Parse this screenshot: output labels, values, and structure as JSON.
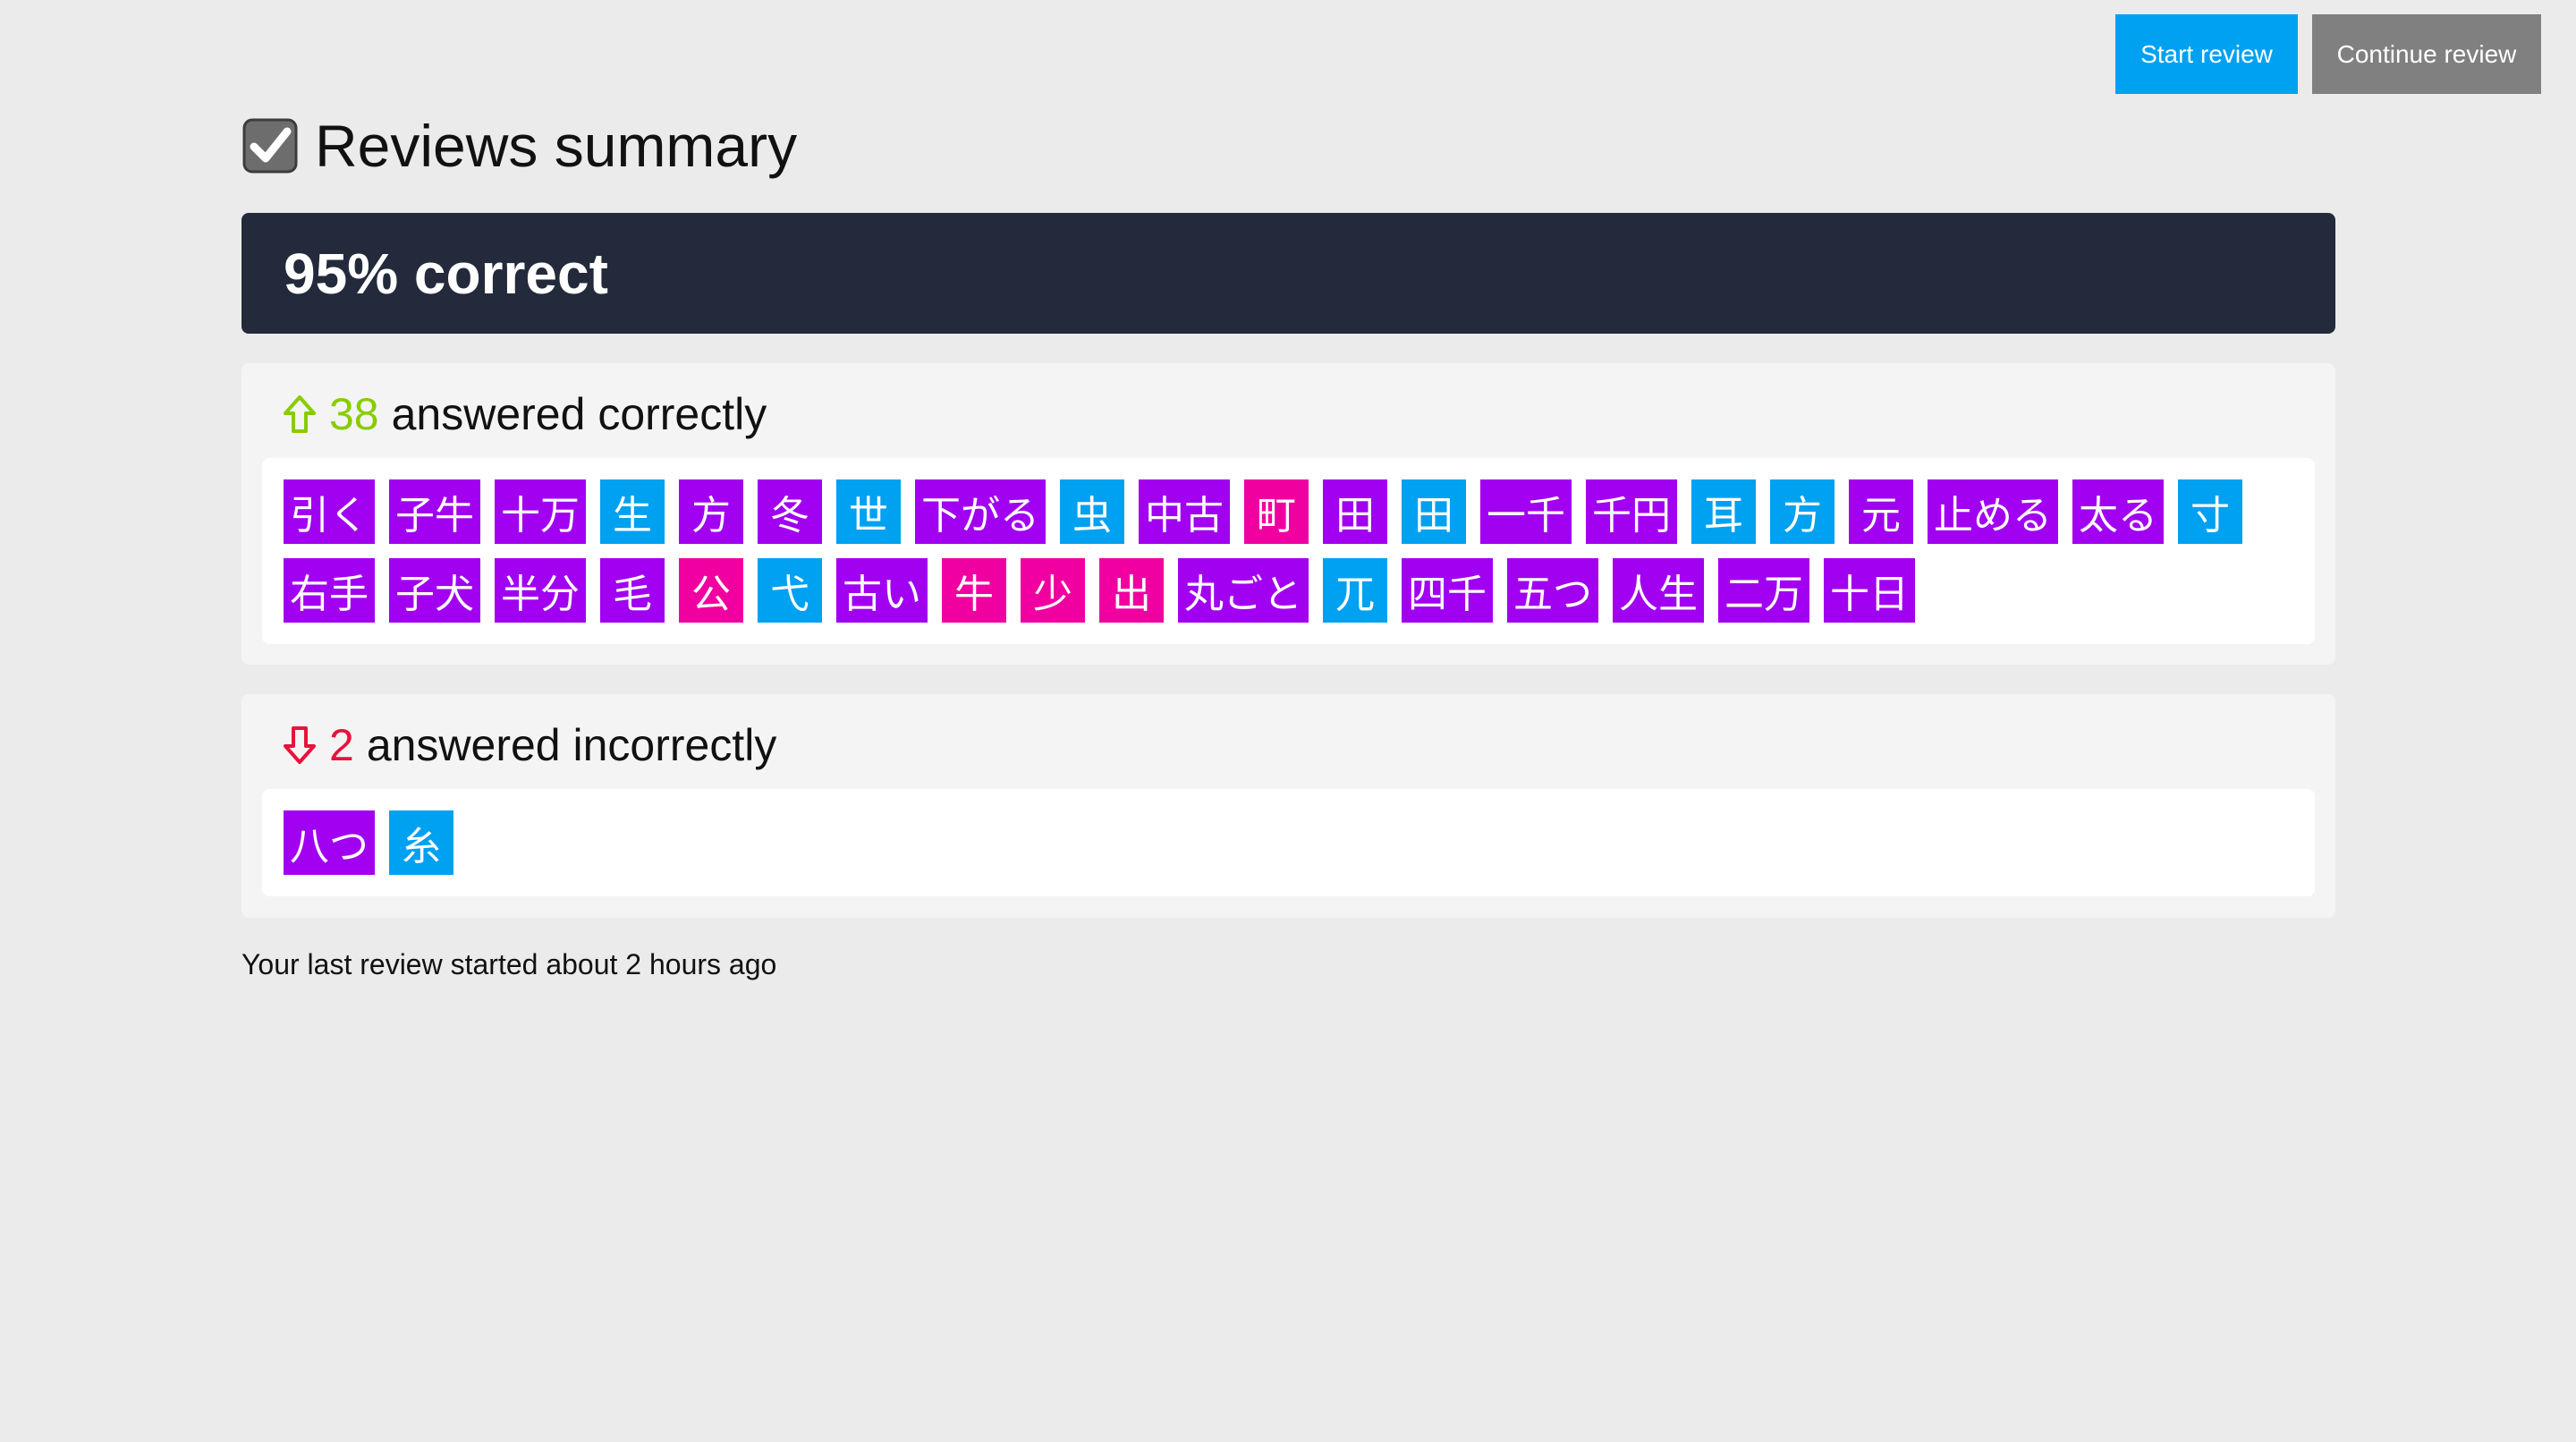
{
  "toolbar": {
    "start_label": "Start review",
    "continue_label": "Continue review"
  },
  "header": {
    "title": "Reviews summary",
    "icon": "checkbox-checked-icon"
  },
  "score": {
    "text": "95% correct"
  },
  "correct": {
    "count": "38",
    "label": "answered correctly",
    "icon": "arrow-up-icon",
    "color": "#88cc00",
    "items": [
      {
        "text": "引く",
        "type": "vocabulary"
      },
      {
        "text": "子牛",
        "type": "vocabulary"
      },
      {
        "text": "十万",
        "type": "vocabulary"
      },
      {
        "text": "生",
        "type": "radical"
      },
      {
        "text": "方",
        "type": "vocabulary"
      },
      {
        "text": "冬",
        "type": "vocabulary"
      },
      {
        "text": "世",
        "type": "radical"
      },
      {
        "text": "下がる",
        "type": "vocabulary"
      },
      {
        "text": "虫",
        "type": "radical"
      },
      {
        "text": "中古",
        "type": "vocabulary"
      },
      {
        "text": "町",
        "type": "kanji"
      },
      {
        "text": "田",
        "type": "vocabulary"
      },
      {
        "text": "田",
        "type": "radical"
      },
      {
        "text": "一千",
        "type": "vocabulary"
      },
      {
        "text": "千円",
        "type": "vocabulary"
      },
      {
        "text": "耳",
        "type": "radical"
      },
      {
        "text": "方",
        "type": "radical"
      },
      {
        "text": "元",
        "type": "vocabulary"
      },
      {
        "text": "止める",
        "type": "vocabulary"
      },
      {
        "text": "太る",
        "type": "vocabulary"
      },
      {
        "text": "寸",
        "type": "radical"
      },
      {
        "text": "右手",
        "type": "vocabulary"
      },
      {
        "text": "子犬",
        "type": "vocabulary"
      },
      {
        "text": "半分",
        "type": "vocabulary"
      },
      {
        "text": "毛",
        "type": "vocabulary"
      },
      {
        "text": "公",
        "type": "kanji"
      },
      {
        "text": "弋",
        "type": "radical"
      },
      {
        "text": "古い",
        "type": "vocabulary"
      },
      {
        "text": "牛",
        "type": "kanji"
      },
      {
        "text": "少",
        "type": "kanji"
      },
      {
        "text": "出",
        "type": "kanji"
      },
      {
        "text": "丸ごと",
        "type": "vocabulary"
      },
      {
        "text": "兀",
        "type": "radical"
      },
      {
        "text": "四千",
        "type": "vocabulary"
      },
      {
        "text": "五つ",
        "type": "vocabulary"
      },
      {
        "text": "人生",
        "type": "vocabulary"
      },
      {
        "text": "二万",
        "type": "vocabulary"
      },
      {
        "text": "十日",
        "type": "vocabulary"
      }
    ]
  },
  "incorrect": {
    "count": "2",
    "label": "answered incorrectly",
    "icon": "arrow-down-icon",
    "color": "#e8123b",
    "items": [
      {
        "text": "八つ",
        "type": "vocabulary"
      },
      {
        "text": "糸",
        "type": "radical"
      }
    ]
  },
  "footer": {
    "text": "Your last review started about 2 hours ago"
  },
  "colors": {
    "radical": "#00a1f1",
    "kanji": "#f100a1",
    "vocabulary": "#a100f1",
    "banner": "#232a3b",
    "start_button": "#00a1f1",
    "continue_button": "#808080"
  }
}
